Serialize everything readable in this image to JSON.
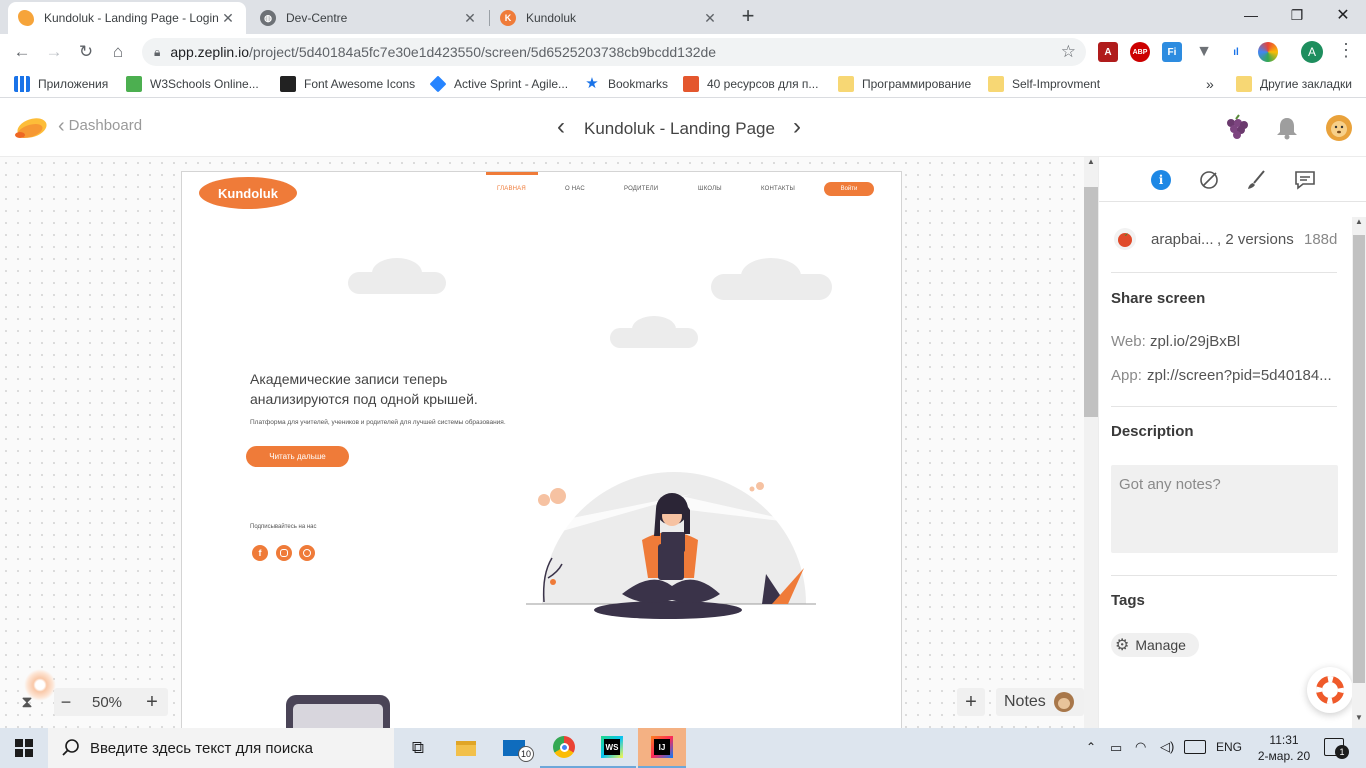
{
  "browser": {
    "tabs": [
      {
        "title": "Kundoluk - Landing Page - Login",
        "icon": "zeplin-icon"
      },
      {
        "title": "Dev-Centre",
        "icon": "globe-icon"
      },
      {
        "title": "Kundoluk",
        "icon": "k-icon"
      }
    ],
    "url_host": "app.zeplin.io",
    "url_path": "/project/5d40184a5fc7e30e1d423550/screen/5d6525203738cb9bcdd132de",
    "profile_initial": "A",
    "bookmarks": [
      "Приложения",
      "W3Schools Online...",
      "Font Awesome Icons",
      "Active Sprint - Agile...",
      "Bookmarks",
      "40 ресурсов для п...",
      "Программирование",
      "Self-Improvment"
    ],
    "bookmarks_more": "»",
    "other_bookmarks": "Другие закладки"
  },
  "zeplin": {
    "back_label": "Dashboard",
    "screen_title": "Kundoluk - Landing Page",
    "zoom": "50%",
    "notes_label": "Notes"
  },
  "artboard": {
    "logo": "Kundoluk",
    "nav": [
      "ГЛАВНАЯ",
      "О НАС",
      "РОДИТЕЛИ",
      "ШКОЛЫ",
      "КОНТАКТЫ"
    ],
    "login": "Войти",
    "headline_1": "Академические записи теперь",
    "headline_2": "анализируются под одной крышей.",
    "subtext": "Платформа для учителей, учеников и родителей для лучшей системы образования.",
    "cta": "Читать дальше",
    "subscribe": "Подписывайтесь на нас"
  },
  "panel": {
    "author": "arapbai...",
    "versions": ", 2 versions",
    "age": "188d",
    "share_heading": "Share screen",
    "web_label": "Web:",
    "web_value": "zpl.io/29jBxBl",
    "app_label": "App:",
    "app_value": "zpl://screen?pid=5d40184...",
    "description_heading": "Description",
    "notes_placeholder": "Got any notes?",
    "tags_heading": "Tags",
    "manage_label": "Manage"
  },
  "taskbar": {
    "search_placeholder": "Введите здесь текст для поиска",
    "mail_badge": "10",
    "lang": "ENG",
    "time": "11:31",
    "date": "2-мар. 20",
    "notif_count": "1"
  },
  "colors": {
    "accent": "#ef7b39",
    "zeplin_blue": "#1e88e5"
  }
}
